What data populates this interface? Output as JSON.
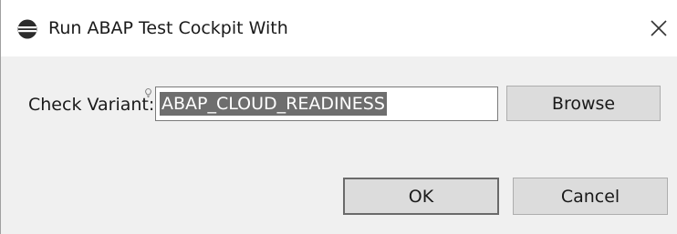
{
  "window": {
    "title": "Run ABAP Test Cockpit With",
    "app_icon": "eclipse-icon",
    "close_icon": "close-icon"
  },
  "form": {
    "check_variant_label": "Check Variant:",
    "check_variant_value": "ABAP_CLOUD_READINESS",
    "content_assist_icon": "lightbulb-hint-icon",
    "browse_label": "Browse"
  },
  "footer": {
    "ok_label": "OK",
    "cancel_label": "Cancel"
  },
  "colors": {
    "dialog_background": "#f0f0f0",
    "titlebar_background": "#ffffff",
    "selection_highlight": "#6e6e6e",
    "button_background": "#dcdcdc"
  }
}
